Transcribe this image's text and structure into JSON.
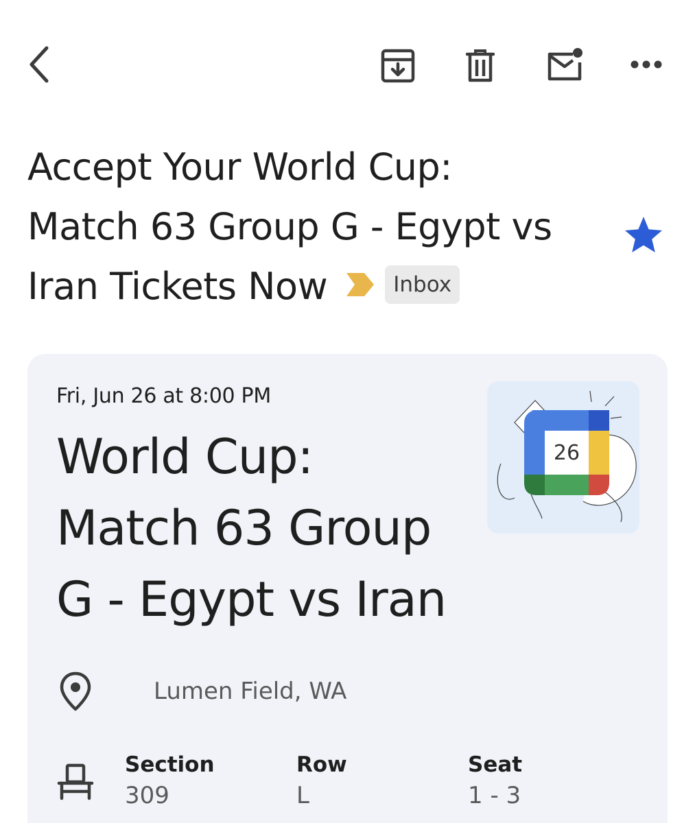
{
  "toolbar": {
    "back": "back-icon",
    "archive": "archive-icon",
    "delete": "trash-icon",
    "mark_unread": "mark-unread-icon",
    "more": "more-icon"
  },
  "email": {
    "subject_lines": [
      "Accept Your World Cup:",
      "Match 63 Group G - Egypt vs",
      "Iran Tickets Now"
    ],
    "label": "Inbox",
    "starred": true,
    "importance_color": "#e8b64a",
    "star_color": "#2c5dd6"
  },
  "event_card": {
    "date": "Fri, Jun 26 at 8:00 PM",
    "title_lines": [
      "World Cup:",
      "Match 63 Group",
      "G - Egypt vs Iran"
    ],
    "calendar_day": "26",
    "location": "Lumen Field, WA",
    "seating": {
      "section_label": "Section",
      "section_value": "309",
      "row_label": "Row",
      "row_value": "L",
      "seat_label": "Seat",
      "seat_value": "1 - 3"
    }
  }
}
